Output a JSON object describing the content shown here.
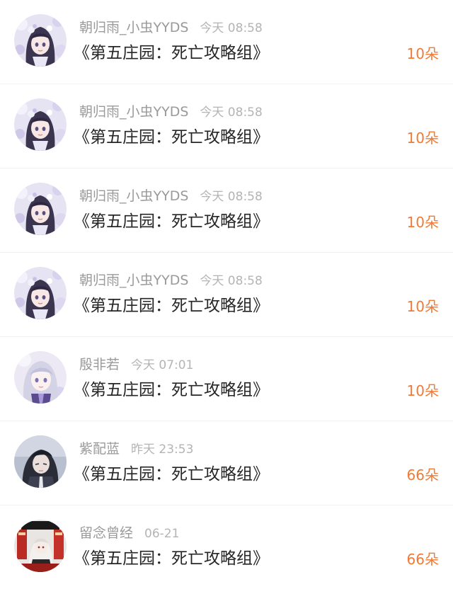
{
  "colors": {
    "username": "#9a9a9a",
    "time": "#b4b4b4",
    "title": "#262626",
    "amount": "#f07a36",
    "divider": "#f1f1f1"
  },
  "items": [
    {
      "username": "朝归雨_小虫YYDS",
      "time": "今天 08:58",
      "title": "《第五庄园：死亡攻略组》",
      "amount": "10朵",
      "avatar": "anime-girl-avatar-lavender"
    },
    {
      "username": "朝归雨_小虫YYDS",
      "time": "今天 08:58",
      "title": "《第五庄园：死亡攻略组》",
      "amount": "10朵",
      "avatar": "anime-girl-avatar-lavender"
    },
    {
      "username": "朝归雨_小虫YYDS",
      "time": "今天 08:58",
      "title": "《第五庄园：死亡攻略组》",
      "amount": "10朵",
      "avatar": "anime-girl-avatar-lavender"
    },
    {
      "username": "朝归雨_小虫YYDS",
      "time": "今天 08:58",
      "title": "《第五庄园：死亡攻略组》",
      "amount": "10朵",
      "avatar": "anime-girl-avatar-lavender"
    },
    {
      "username": "殷非若",
      "time": "今天 07:01",
      "title": "《第五庄园：死亡攻略组》",
      "amount": "10朵",
      "avatar": "anime-girl-avatar-silver"
    },
    {
      "username": "紫配蓝",
      "time": "昨天 23:53",
      "title": "《第五庄园：死亡攻略组》",
      "amount": "66朵",
      "avatar": "anime-boy-avatar-dark"
    },
    {
      "username": "留念曾经",
      "time": "06-21",
      "title": "《第五庄园：死亡攻略组》",
      "amount": "66朵",
      "avatar": "anime-figure-avatar-red"
    }
  ]
}
